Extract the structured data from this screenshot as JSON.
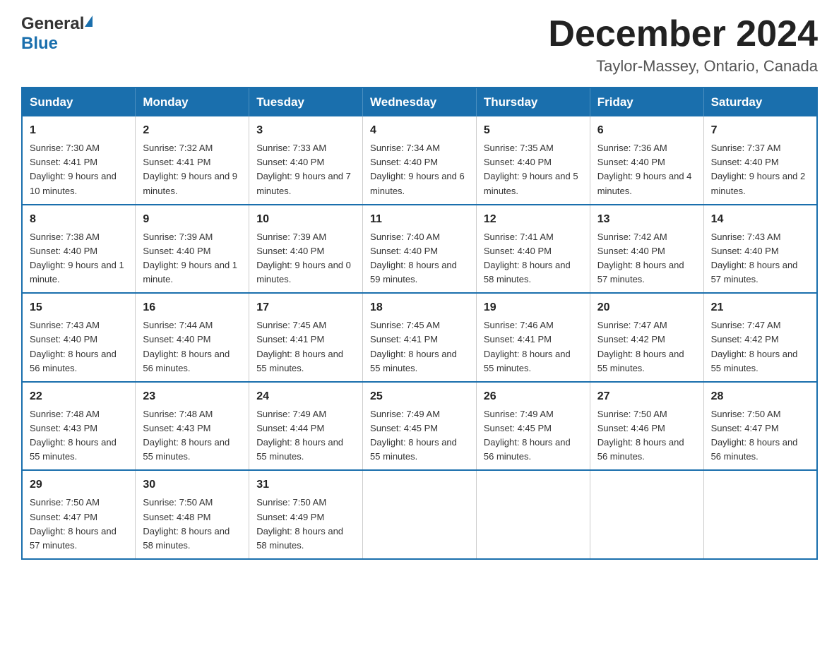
{
  "header": {
    "logo_general": "General",
    "logo_blue": "Blue",
    "month_title": "December 2024",
    "location": "Taylor-Massey, Ontario, Canada"
  },
  "days_of_week": [
    "Sunday",
    "Monday",
    "Tuesday",
    "Wednesday",
    "Thursday",
    "Friday",
    "Saturday"
  ],
  "weeks": [
    [
      {
        "day": "1",
        "sunrise": "7:30 AM",
        "sunset": "4:41 PM",
        "daylight": "9 hours and 10 minutes."
      },
      {
        "day": "2",
        "sunrise": "7:32 AM",
        "sunset": "4:41 PM",
        "daylight": "9 hours and 9 minutes."
      },
      {
        "day": "3",
        "sunrise": "7:33 AM",
        "sunset": "4:40 PM",
        "daylight": "9 hours and 7 minutes."
      },
      {
        "day": "4",
        "sunrise": "7:34 AM",
        "sunset": "4:40 PM",
        "daylight": "9 hours and 6 minutes."
      },
      {
        "day": "5",
        "sunrise": "7:35 AM",
        "sunset": "4:40 PM",
        "daylight": "9 hours and 5 minutes."
      },
      {
        "day": "6",
        "sunrise": "7:36 AM",
        "sunset": "4:40 PM",
        "daylight": "9 hours and 4 minutes."
      },
      {
        "day": "7",
        "sunrise": "7:37 AM",
        "sunset": "4:40 PM",
        "daylight": "9 hours and 2 minutes."
      }
    ],
    [
      {
        "day": "8",
        "sunrise": "7:38 AM",
        "sunset": "4:40 PM",
        "daylight": "9 hours and 1 minute."
      },
      {
        "day": "9",
        "sunrise": "7:39 AM",
        "sunset": "4:40 PM",
        "daylight": "9 hours and 1 minute."
      },
      {
        "day": "10",
        "sunrise": "7:39 AM",
        "sunset": "4:40 PM",
        "daylight": "9 hours and 0 minutes."
      },
      {
        "day": "11",
        "sunrise": "7:40 AM",
        "sunset": "4:40 PM",
        "daylight": "8 hours and 59 minutes."
      },
      {
        "day": "12",
        "sunrise": "7:41 AM",
        "sunset": "4:40 PM",
        "daylight": "8 hours and 58 minutes."
      },
      {
        "day": "13",
        "sunrise": "7:42 AM",
        "sunset": "4:40 PM",
        "daylight": "8 hours and 57 minutes."
      },
      {
        "day": "14",
        "sunrise": "7:43 AM",
        "sunset": "4:40 PM",
        "daylight": "8 hours and 57 minutes."
      }
    ],
    [
      {
        "day": "15",
        "sunrise": "7:43 AM",
        "sunset": "4:40 PM",
        "daylight": "8 hours and 56 minutes."
      },
      {
        "day": "16",
        "sunrise": "7:44 AM",
        "sunset": "4:40 PM",
        "daylight": "8 hours and 56 minutes."
      },
      {
        "day": "17",
        "sunrise": "7:45 AM",
        "sunset": "4:41 PM",
        "daylight": "8 hours and 55 minutes."
      },
      {
        "day": "18",
        "sunrise": "7:45 AM",
        "sunset": "4:41 PM",
        "daylight": "8 hours and 55 minutes."
      },
      {
        "day": "19",
        "sunrise": "7:46 AM",
        "sunset": "4:41 PM",
        "daylight": "8 hours and 55 minutes."
      },
      {
        "day": "20",
        "sunrise": "7:47 AM",
        "sunset": "4:42 PM",
        "daylight": "8 hours and 55 minutes."
      },
      {
        "day": "21",
        "sunrise": "7:47 AM",
        "sunset": "4:42 PM",
        "daylight": "8 hours and 55 minutes."
      }
    ],
    [
      {
        "day": "22",
        "sunrise": "7:48 AM",
        "sunset": "4:43 PM",
        "daylight": "8 hours and 55 minutes."
      },
      {
        "day": "23",
        "sunrise": "7:48 AM",
        "sunset": "4:43 PM",
        "daylight": "8 hours and 55 minutes."
      },
      {
        "day": "24",
        "sunrise": "7:49 AM",
        "sunset": "4:44 PM",
        "daylight": "8 hours and 55 minutes."
      },
      {
        "day": "25",
        "sunrise": "7:49 AM",
        "sunset": "4:45 PM",
        "daylight": "8 hours and 55 minutes."
      },
      {
        "day": "26",
        "sunrise": "7:49 AM",
        "sunset": "4:45 PM",
        "daylight": "8 hours and 56 minutes."
      },
      {
        "day": "27",
        "sunrise": "7:50 AM",
        "sunset": "4:46 PM",
        "daylight": "8 hours and 56 minutes."
      },
      {
        "day": "28",
        "sunrise": "7:50 AM",
        "sunset": "4:47 PM",
        "daylight": "8 hours and 56 minutes."
      }
    ],
    [
      {
        "day": "29",
        "sunrise": "7:50 AM",
        "sunset": "4:47 PM",
        "daylight": "8 hours and 57 minutes."
      },
      {
        "day": "30",
        "sunrise": "7:50 AM",
        "sunset": "4:48 PM",
        "daylight": "8 hours and 58 minutes."
      },
      {
        "day": "31",
        "sunrise": "7:50 AM",
        "sunset": "4:49 PM",
        "daylight": "8 hours and 58 minutes."
      },
      null,
      null,
      null,
      null
    ]
  ]
}
